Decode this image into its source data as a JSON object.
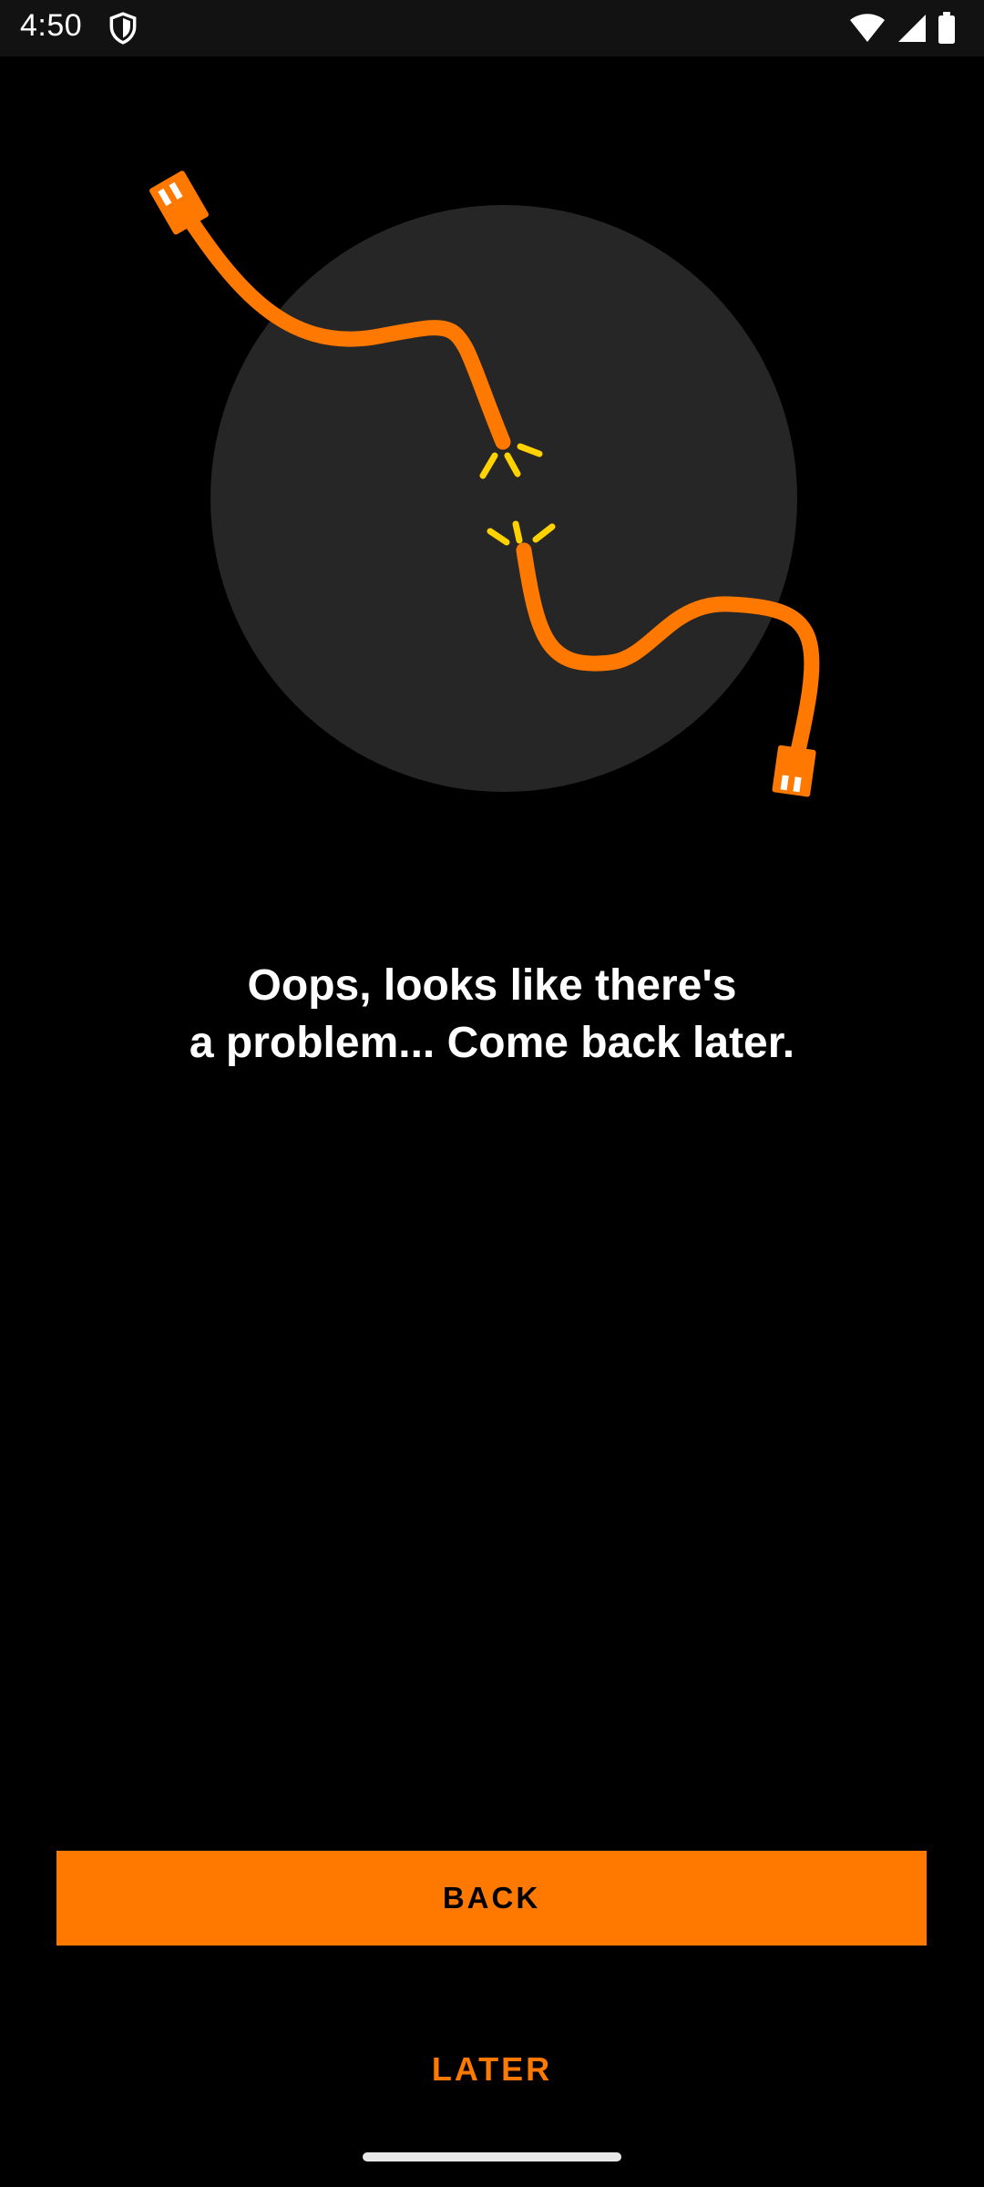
{
  "status_bar": {
    "time": "4:50",
    "icons": [
      "shield-icon",
      "wifi-icon",
      "cellular-signal-icon",
      "battery-icon"
    ]
  },
  "illustration": {
    "icons": [
      "broken-cable-illustration"
    ],
    "colors": {
      "circle": "#262626",
      "cable": "#ff7900",
      "spark": "#ffd200"
    }
  },
  "message": {
    "line1": "Oops, looks like there's",
    "line2": "a problem... Come back later."
  },
  "actions": {
    "back_label": "BACK",
    "later_label": "LATER"
  },
  "colors": {
    "accent": "#ff7900",
    "background": "#000000"
  }
}
